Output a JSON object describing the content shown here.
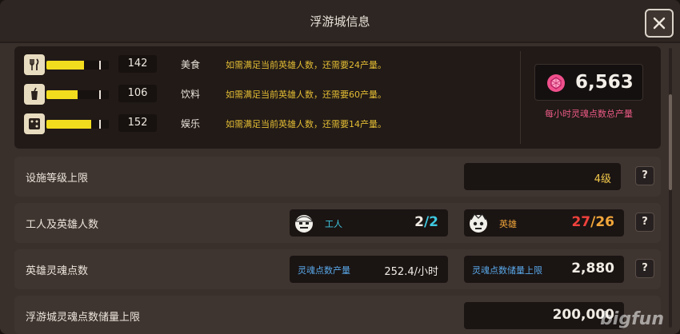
{
  "window": {
    "title": "浮游城信息",
    "close_label": "✕"
  },
  "stats": [
    {
      "icon": "food-icon",
      "value": "142",
      "label": "美食",
      "note": "如需满足当前英雄人数，还需要24产量。",
      "fill": 0.6,
      "mark": 0.84
    },
    {
      "icon": "drink-icon",
      "value": "106",
      "label": "饮料",
      "note": "如需满足当前英雄人数，还需要60产量。",
      "fill": 0.5,
      "mark": 0.84
    },
    {
      "icon": "dice-icon",
      "value": "152",
      "label": "娱乐",
      "note": "如需满足当前英雄人数，还需要14产量。",
      "fill": 0.72,
      "mark": 0.84
    }
  ],
  "soul": {
    "value": "6,563",
    "caption": "每小时灵魂点数总产量"
  },
  "rows": {
    "facility": {
      "label": "设施等级上限",
      "value": "4级",
      "help": "?"
    },
    "population": {
      "label": "工人及英雄人数",
      "worker_label": "工人",
      "worker_current": "2",
      "worker_sep": "/",
      "worker_max": "2",
      "hero_label": "英雄",
      "hero_current": "27",
      "hero_sep": "/",
      "hero_max": "26",
      "help": "?"
    },
    "soul_points": {
      "label": "英雄灵魂点数",
      "output_label": "灵魂点数产量",
      "output_value": "252.4/小时",
      "storage_label": "灵魂点数储量上限",
      "storage_value": "2,880",
      "help": "?"
    },
    "city_storage": {
      "label": "浮游城灵魂点数储量上限",
      "value": "200,000"
    }
  },
  "watermark": "bigfun",
  "colors": {
    "bar_fill": "#f2dc1e",
    "note": "#e4bd34",
    "soul_caption": "#ec5a86",
    "worker_accent": "#3ec8e0",
    "hero_current": "#f0413c",
    "hero_accent": "#f2a63a",
    "blue_label": "#59a8e8"
  }
}
